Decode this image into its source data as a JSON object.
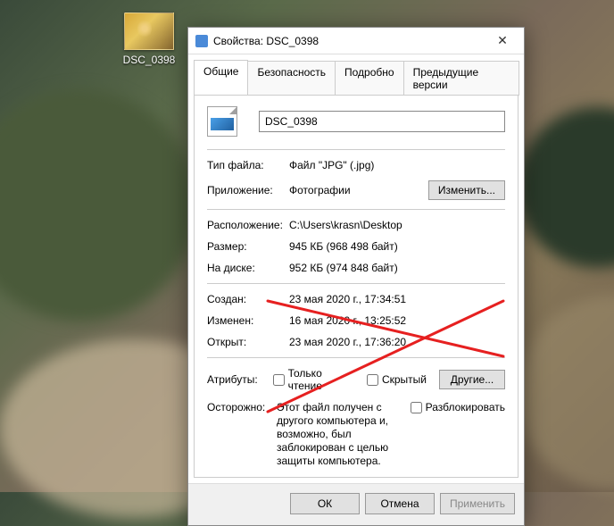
{
  "desktop": {
    "icon_label": "DSC_0398"
  },
  "dialog": {
    "title": "Свойства: DSC_0398",
    "tabs": [
      "Общие",
      "Безопасность",
      "Подробно",
      "Предыдущие версии"
    ],
    "active_tab": 0,
    "filename": "DSC_0398",
    "labels": {
      "filetype": "Тип файла:",
      "app": "Приложение:",
      "location": "Расположение:",
      "size": "Размер:",
      "ondisk": "На диске:",
      "created": "Создан:",
      "modified": "Изменен:",
      "accessed": "Открыт:",
      "attributes": "Атрибуты:",
      "security": "Осторожно:"
    },
    "values": {
      "filetype": "Файл \"JPG\" (.jpg)",
      "app": "Фотографии",
      "location": "C:\\Users\\krasn\\Desktop",
      "size": "945 КБ (968 498 байт)",
      "ondisk": "952 КБ (974 848 байт)",
      "created": "23 мая 2020 г., 17:34:51",
      "modified": "16 мая 2020 г., 13:25:52",
      "accessed": "23 мая 2020 г., 17:36:20"
    },
    "buttons": {
      "change": "Изменить...",
      "advanced": "Другие...",
      "ok": "ОК",
      "cancel": "Отмена",
      "apply": "Применить"
    },
    "checkboxes": {
      "readonly": "Только чтение",
      "hidden": "Скрытый",
      "unblock": "Разблокировать"
    },
    "security_text": "Этот файл получен с другого компьютера и, возможно, был заблокирован с целью защиты компьютера."
  }
}
